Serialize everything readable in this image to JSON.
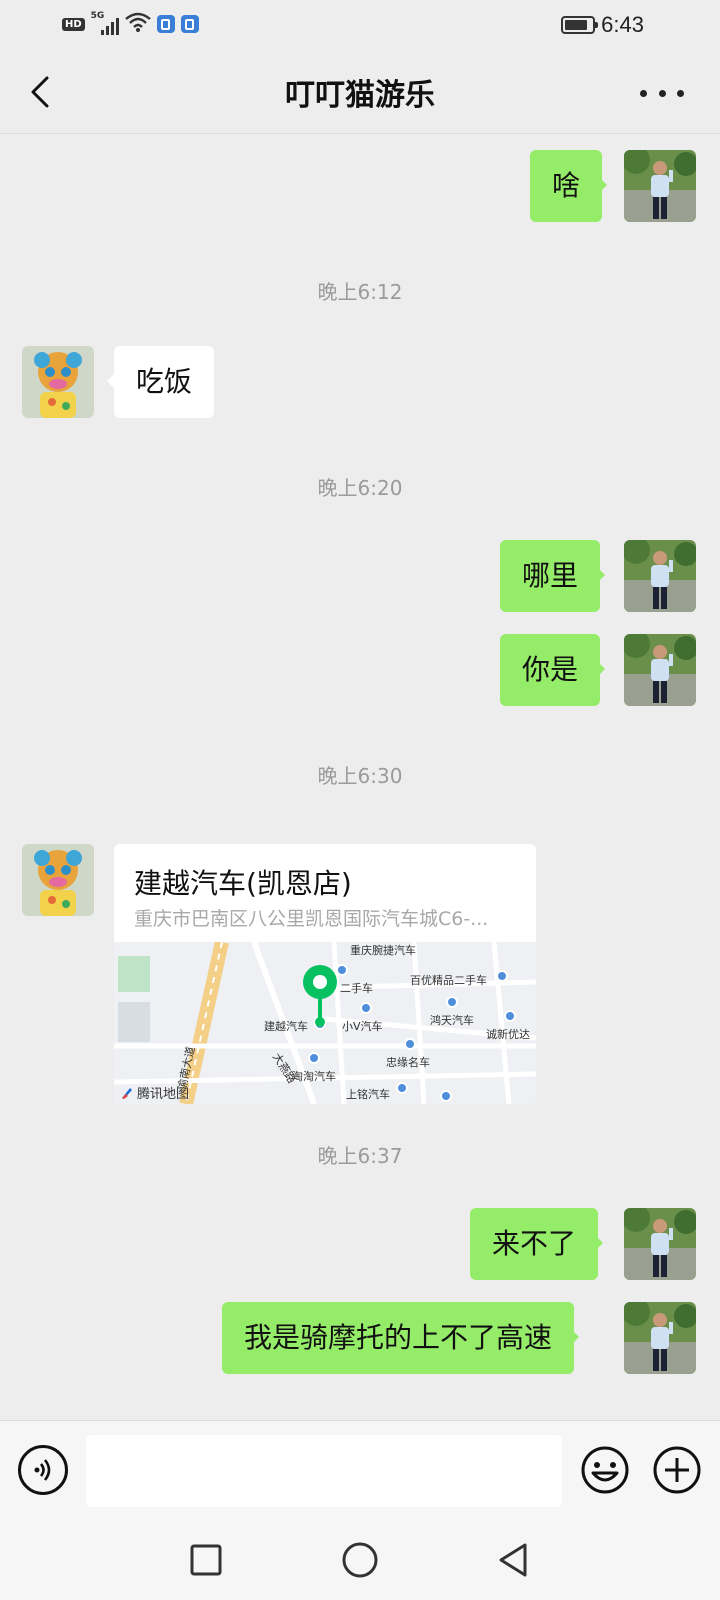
{
  "status_bar": {
    "hd": "HD",
    "network": "5G",
    "time": "6:43",
    "battery_level": 0.85
  },
  "header": {
    "title": "叮叮猫游乐",
    "back_icon": "chevron-left-icon",
    "more_icon": "more-dots-icon"
  },
  "messages": {
    "m1": "啥",
    "ts1": "晚上6:12",
    "m2": "吃饭",
    "ts2": "晚上6:20",
    "m3": "哪里",
    "m4": "你是",
    "ts3": "晚上6:30",
    "location": {
      "name": "建越汽车(凯恩店)",
      "address": "重庆市巴南区八公里凯恩国际汽车城C6-...",
      "map_labels": [
        "重庆腕捷汽车",
        "百优精品二手车",
        "二手车",
        "建越汽车",
        "小V汽车",
        "鸿天汽车",
        "诚新优达",
        "忠缘名车",
        "淘淘汽车",
        "上铭汽车",
        "大燕路",
        "渝南大道"
      ],
      "map_brand": "腾讯地图"
    },
    "ts4": "晚上6:37",
    "m5": "来不了",
    "m6": "我是骑摩托的上不了高速"
  },
  "input_bar": {
    "placeholder": "",
    "voice_icon": "voice-icon",
    "emoji_icon": "emoji-icon",
    "plus_icon": "plus-icon"
  },
  "nav_bar": {
    "icons": [
      "square-recent-icon",
      "circle-home-icon",
      "triangle-back-icon"
    ]
  },
  "colors": {
    "bubble_out": "#95ec69",
    "bubble_in": "#ffffff",
    "background": "#ededed",
    "map_pin": "#07c160"
  }
}
